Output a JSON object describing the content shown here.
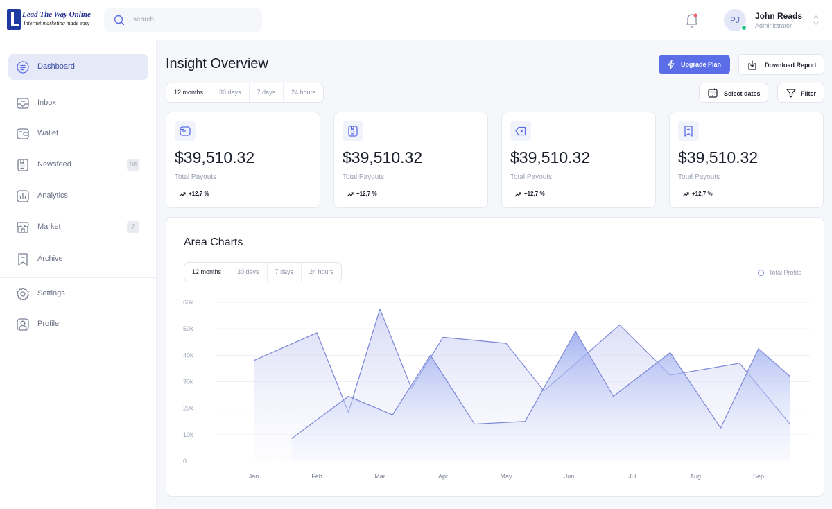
{
  "brand": {
    "name": "Lead The Way Online",
    "tagline": "Internet marketing made easy"
  },
  "search": {
    "placeholder": "search"
  },
  "user": {
    "initials": "PJ",
    "name": "John Reads",
    "role": "Administrator"
  },
  "sidebar": {
    "items": [
      {
        "label": "Dashboard",
        "icon": "dashboard-icon",
        "active": true
      },
      {
        "label": "Inbox",
        "icon": "inbox-icon"
      },
      {
        "label": "Wallet",
        "icon": "wallet-icon"
      },
      {
        "label": "Newsfeed",
        "icon": "newsfeed-icon",
        "badge": "88"
      },
      {
        "label": "Analytics",
        "icon": "analytics-icon"
      },
      {
        "label": "Market",
        "icon": "market-icon",
        "badge": "7"
      },
      {
        "label": "Archive",
        "icon": "archive-icon"
      },
      {
        "label": "Settings",
        "icon": "gear-icon"
      },
      {
        "label": "Profile",
        "icon": "profile-icon"
      }
    ]
  },
  "header": {
    "title": "Insight Overview",
    "upgrade_label": "Upgrade Plan",
    "download_label": "Download Report",
    "ranges": [
      "12 months",
      "30 days",
      "7 days",
      "24 hours"
    ],
    "select_dates_label": "Select dates",
    "filter_label": "Filter"
  },
  "stats": [
    {
      "value": "$39,510.32",
      "label": "Total Payouts",
      "trend": "+12,7 %",
      "icon": "wallet-card-icon"
    },
    {
      "value": "$39,510.32",
      "label": "Total Payouts",
      "trend": "+12,7 %",
      "icon": "clipboard-icon"
    },
    {
      "value": "$39,510.32",
      "label": "Total Payouts",
      "trend": "+12,7 %",
      "icon": "backspace-icon"
    },
    {
      "value": "$39,510.32",
      "label": "Total Payouts",
      "trend": "+12,7 %",
      "icon": "receipt-icon"
    }
  ],
  "chart_panel": {
    "title": "Area Charts",
    "ranges": [
      "12 months",
      "30 days",
      "7 days",
      "24 hours"
    ],
    "legend_label": "Total Profits"
  },
  "colors": {
    "accent": "#5b6ee8",
    "line": "#7b86d6",
    "online": "#21c78a"
  },
  "chart_data": {
    "type": "area",
    "title": "Area Charts",
    "categories": [
      "Jan",
      "Feb",
      "Mar",
      "Apr",
      "May",
      "Jun",
      "Jul",
      "Aug",
      "Sep"
    ],
    "yticks": [
      "0",
      "10k",
      "20k",
      "30k",
      "40k",
      "50k",
      "60k"
    ],
    "ylim": [
      0,
      60000
    ],
    "grid": true,
    "legend": "top-right",
    "series": [
      {
        "name": "",
        "x": [
          0,
          1,
          1.5,
          2,
          2.5,
          3,
          4,
          4.6,
          5.8,
          6.6,
          7.7,
          8.5
        ],
        "values": [
          38000,
          48500,
          18500,
          57500,
          27500,
          46800,
          44500,
          26500,
          51500,
          32500,
          37000,
          14000
        ]
      },
      {
        "name": "Total Profits",
        "x": [
          0.6,
          1.5,
          2.2,
          2.8,
          3.5,
          4.3,
          5.1,
          5.7,
          6.6,
          7.4,
          8.0,
          8.5
        ],
        "values": [
          8500,
          24500,
          17500,
          40000,
          14000,
          15000,
          49000,
          24500,
          41000,
          12500,
          42500,
          32000
        ]
      }
    ]
  }
}
